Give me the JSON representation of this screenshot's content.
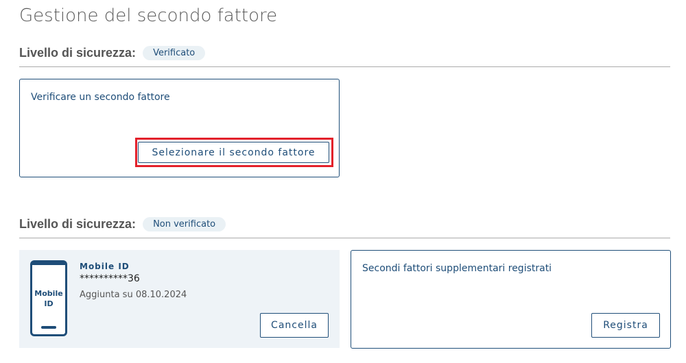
{
  "page_title": "Gestione del secondo fattore",
  "verified_section": {
    "level_label": "Livello di sicurezza:",
    "badge": "Verificato",
    "card_title": "Verificare un secondo fattore",
    "button_label": "Selezionare il secondo fattore"
  },
  "unverified_section": {
    "level_label": "Livello di sicurezza:",
    "badge": "Non verificato",
    "device": {
      "icon_line1": "Mobile",
      "icon_line2": "ID",
      "name": "Mobile ID",
      "number": "**********36",
      "added": "Aggiunta su 08.10.2024",
      "delete_label": "Cancella"
    },
    "additional_card": {
      "title": "Secondi fattori supplementari registrati",
      "register_label": "Registra"
    }
  },
  "colors": {
    "brand": "#1e4d78",
    "highlight": "#e3202a",
    "badge_bg": "#eaf1f5",
    "device_bg": "#eef3f7"
  }
}
